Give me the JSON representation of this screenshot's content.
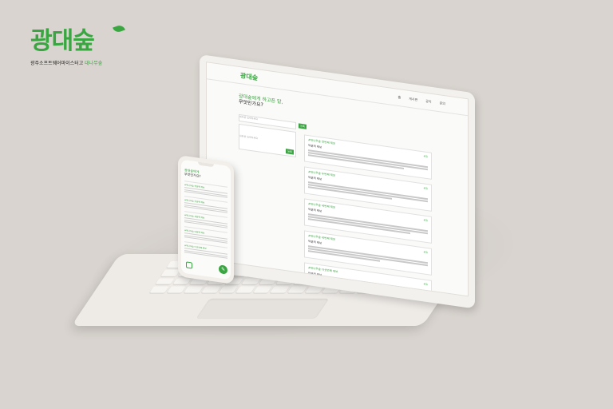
{
  "brand": {
    "logo": "광대숲",
    "subtitle_main": "광주소프트웨어마이스터고 ",
    "subtitle_highlight": "대나무숲"
  },
  "laptop": {
    "logo": "광대숲",
    "nav": [
      "홈",
      "게시판",
      "공지",
      "문의"
    ],
    "question_line1": "광대숲에게 하고픈 말,",
    "question_line2": "무엇인가요?",
    "title_placeholder": "제목을 입력하세요",
    "content_placeholder": "내용을 입력하세요",
    "submit_label": "등록",
    "posts": [
      {
        "title": "#대나무숲 첫번째 제보",
        "sub": "익명의 제보",
        "tag": "공유"
      },
      {
        "title": "#대나무숲 두번째 제보",
        "sub": "익명의 제보",
        "tag": "공유"
      },
      {
        "title": "#대나무숲 세번째 제보",
        "sub": "익명의 제보",
        "tag": "공유"
      },
      {
        "title": "#대나무숲 네번째 제보",
        "sub": "익명의 제보",
        "tag": "공유"
      },
      {
        "title": "#대나무숲 다섯번째 제보",
        "sub": "익명의 제보",
        "tag": "공유"
      }
    ]
  },
  "phone": {
    "question_line1": "광대숲에게",
    "question_line2": "무엇인가요?",
    "posts": [
      "#대나무숲 첫번째 제보",
      "#대나무숲 두번째 제보",
      "#대나무숲 세번째 제보",
      "#대나무숲 네번째 제보",
      "#대나무숲 다섯번째 제보"
    ],
    "fab_label": "✎"
  },
  "colors": {
    "accent": "#3aa641",
    "background": "#d9d4cf"
  }
}
